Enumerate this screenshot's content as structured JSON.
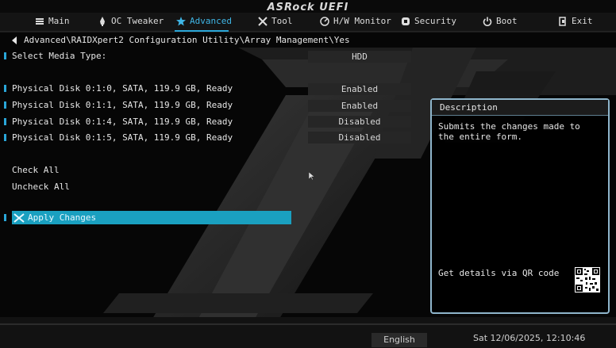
{
  "brand": "ASRock UEFI",
  "nav": {
    "items": [
      {
        "label": "Main",
        "icon": "list-icon"
      },
      {
        "label": "OC Tweaker",
        "icon": "rocket-icon"
      },
      {
        "label": "Advanced",
        "icon": "star-icon",
        "active": true
      },
      {
        "label": "Tool",
        "icon": "tools-icon"
      },
      {
        "label": "H/W Monitor",
        "icon": "monitor-icon"
      },
      {
        "label": "Security",
        "icon": "shield-icon"
      },
      {
        "label": "Boot",
        "icon": "power-icon"
      },
      {
        "label": "Exit",
        "icon": "exit-icon"
      }
    ]
  },
  "breadcrumb": {
    "path": "Advanced\\RAIDXpert2 Configuration Utility\\Array Management\\Yes"
  },
  "settings": {
    "media_type": {
      "label": "Select Media Type:",
      "value": "HDD"
    },
    "disks": [
      {
        "label": "Physical Disk 0:1:0, SATA, 119.9 GB, Ready",
        "value": "Enabled"
      },
      {
        "label": "Physical Disk 0:1:1, SATA, 119.9 GB, Ready",
        "value": "Enabled"
      },
      {
        "label": "Physical Disk 0:1:4, SATA, 119.9 GB, Ready",
        "value": "Disabled"
      },
      {
        "label": "Physical Disk 0:1:5, SATA, 119.9 GB, Ready",
        "value": "Disabled"
      }
    ],
    "check_all": "Check All",
    "uncheck_all": "Uncheck All",
    "apply_changes": "Apply Changes"
  },
  "description": {
    "title": "Description",
    "text": "Submits the changes made to the entire form.",
    "qr_label": "Get details via QR code"
  },
  "footer": {
    "language": "English",
    "datetime": "Sat 12/06/2025, 12:10:46"
  },
  "colors": {
    "accent": "#2aa6d8",
    "selection": "#1aa0c0"
  }
}
